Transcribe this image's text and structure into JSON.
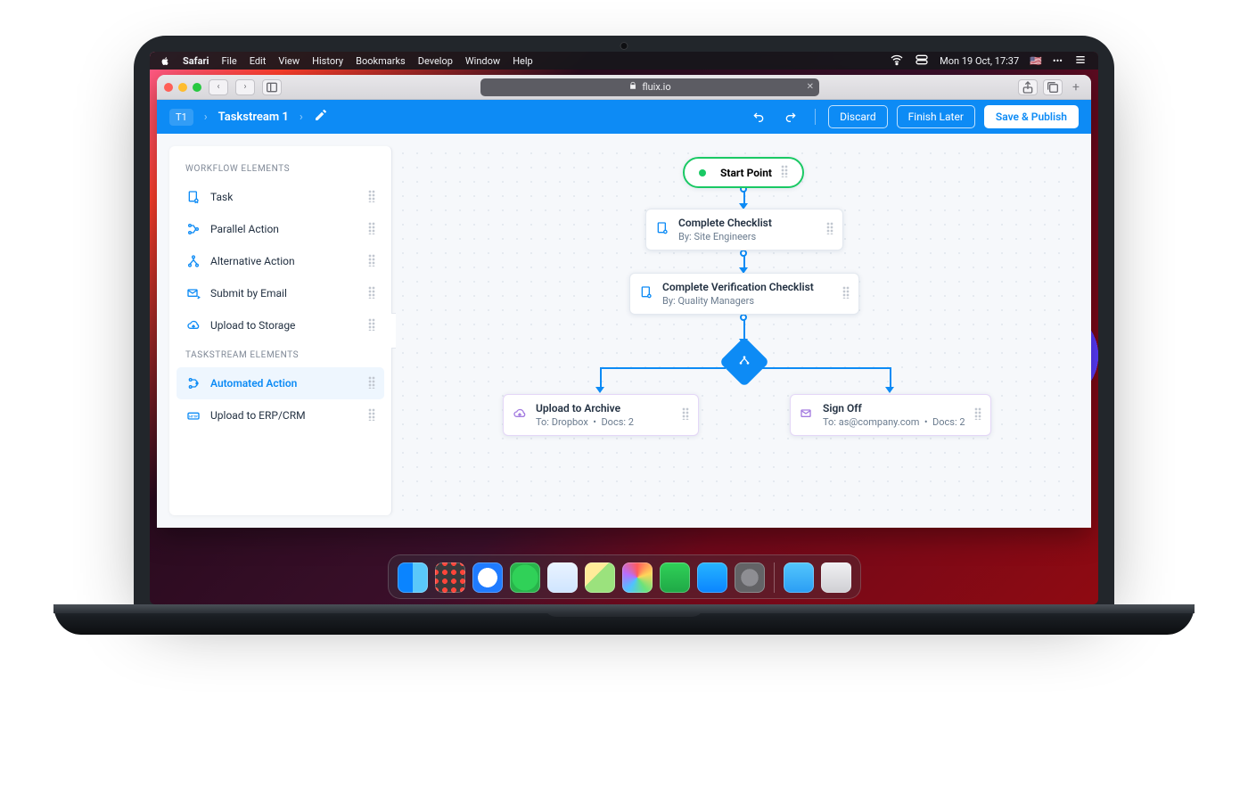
{
  "menubar": {
    "app": "Safari",
    "items": [
      "File",
      "Edit",
      "View",
      "History",
      "Bookmarks",
      "Develop",
      "Window",
      "Help"
    ],
    "clock": "Mon 19 Oct, 17:37",
    "locale": "US"
  },
  "browser": {
    "url_display": "fluix.io",
    "lock": true
  },
  "app": {
    "crumb_code": "T1",
    "crumb_name": "Taskstream 1",
    "buttons": {
      "discard": "Discard",
      "finish_later": "Finish Later",
      "save_publish": "Save & Publish"
    }
  },
  "sidebar": {
    "section_workflow": "WORKFLOW ELEMENTS",
    "section_taskstream": "TASKSTREAM ELEMENTS",
    "items": {
      "task": "Task",
      "parallel": "Parallel Action",
      "alternative": "Alternative Action",
      "submit_email": "Submit by Email",
      "upload_storage": "Upload to Storage",
      "automated": "Automated Action",
      "upload_erp": "Upload to ERP/CRM"
    }
  },
  "flow": {
    "start": "Start Point",
    "checklist": {
      "title": "Complete Checklist",
      "by_prefix": "By:",
      "by_value": "Site Engineers"
    },
    "verification": {
      "title": "Complete Verification Checklist",
      "by_prefix": "By:",
      "by_value": "Quality Managers"
    },
    "upload_archive": {
      "title": "Upload to Archive",
      "to_prefix": "To:",
      "to_value": "Dropbox",
      "docs_label": "Docs:",
      "docs_count": "2"
    },
    "signoff": {
      "title": "Sign Off",
      "to_prefix": "To:",
      "to_value": "as@company.com",
      "docs_label": "Docs:",
      "docs_count": "2"
    }
  }
}
